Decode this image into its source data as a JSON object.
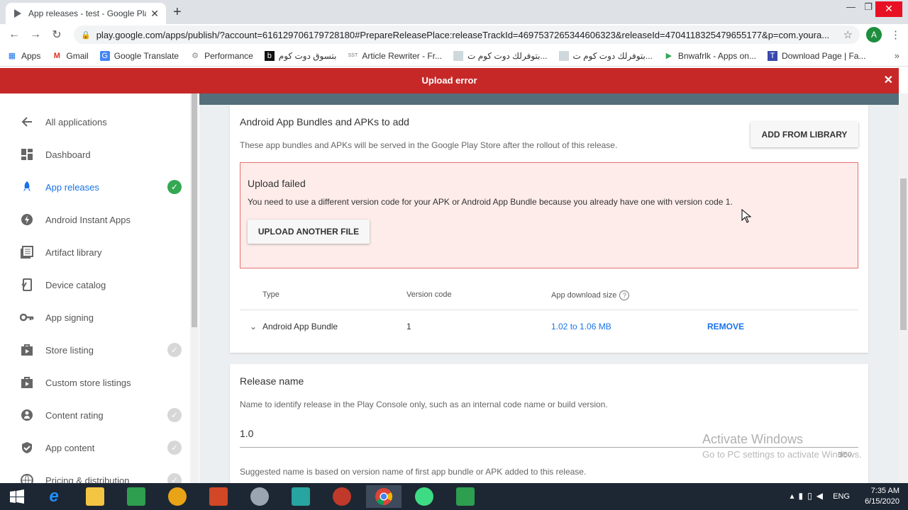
{
  "browser": {
    "tab_title": "App releases - test - Google Play",
    "url": "play.google.com/apps/publish/?account=6161297061797281​80#PrepareReleasePlace:releaseTrackId=4697537265344606323&releaseId=4704118325479655177&p=com.youra...",
    "profile_initial": "A",
    "bookmarks": [
      {
        "label": "Apps",
        "icon": "apps-grid-icon"
      },
      {
        "label": "Gmail",
        "icon": "gmail-icon"
      },
      {
        "label": "Google Translate",
        "icon": "translate-icon"
      },
      {
        "label": "Performance",
        "icon": "performance-icon"
      },
      {
        "label": "بتسوق دوت كوم",
        "icon": "b-icon"
      },
      {
        "label": "Article Rewriter - Fr...",
        "icon": "sst-icon"
      },
      {
        "label": "بتوفرلك دوت كوم ت...",
        "icon": "image-icon"
      },
      {
        "label": "بتوفرلك دوت كوم ت...",
        "icon": "image-icon"
      },
      {
        "label": "Bnwafrlk - Apps on...",
        "icon": "play-icon"
      },
      {
        "label": "Download Page | Fa...",
        "icon": "download-icon"
      }
    ]
  },
  "error_banner": {
    "text": "Upload error"
  },
  "sidebar": {
    "items": [
      {
        "label": "All applications",
        "icon": "arrow-back-icon",
        "status": "none"
      },
      {
        "label": "Dashboard",
        "icon": "dashboard-icon",
        "status": "none"
      },
      {
        "label": "App releases",
        "icon": "rocket-icon",
        "status": "complete",
        "active": true
      },
      {
        "label": "Android Instant Apps",
        "icon": "instant-icon",
        "status": "none"
      },
      {
        "label": "Artifact library",
        "icon": "library-icon",
        "status": "none"
      },
      {
        "label": "Device catalog",
        "icon": "device-icon",
        "status": "none"
      },
      {
        "label": "App signing",
        "icon": "key-icon",
        "status": "none"
      },
      {
        "label": "Store listing",
        "icon": "store-icon",
        "status": "pending"
      },
      {
        "label": "Custom store listings",
        "icon": "store-icon",
        "status": "none"
      },
      {
        "label": "Content rating",
        "icon": "rating-icon",
        "status": "pending"
      },
      {
        "label": "App content",
        "icon": "shield-icon",
        "status": "pending"
      },
      {
        "label": "Pricing & distribution",
        "icon": "globe-icon",
        "status": "pending"
      }
    ]
  },
  "bundles": {
    "title": "Android App Bundles and APKs to add",
    "description": "These app bundles and APKs will be served in the Google Play Store after the rollout of this release.",
    "add_from_library": "ADD FROM LIBRARY",
    "error": {
      "title": "Upload failed",
      "message": "You need to use a different version code for your APK or Android App Bundle because you already have one with version code 1.",
      "button": "UPLOAD ANOTHER FILE"
    },
    "columns": {
      "type": "Type",
      "version_code": "Version code",
      "download_size": "App download size"
    },
    "rows": [
      {
        "type": "Android App Bundle",
        "version_code": "1",
        "download_size": "1.02 to 1.06 MB",
        "action": "REMOVE"
      }
    ]
  },
  "release_name": {
    "title": "Release name",
    "description": "Name to identify release in the Play Console only, such as an internal code name or build version.",
    "value": "1.0",
    "counter": "3/50",
    "hint": "Suggested name is based on version name of first app bundle or APK added to this release."
  },
  "watermark": {
    "line1": "Activate Windows",
    "line2": "Go to PC settings to activate Windows."
  },
  "taskbar": {
    "language": "ENG",
    "time": "7:35 AM",
    "date": "6/15/2020"
  },
  "colors": {
    "error_red": "#c62828",
    "accent_blue": "#1a73e8",
    "success_green": "#34a853"
  }
}
